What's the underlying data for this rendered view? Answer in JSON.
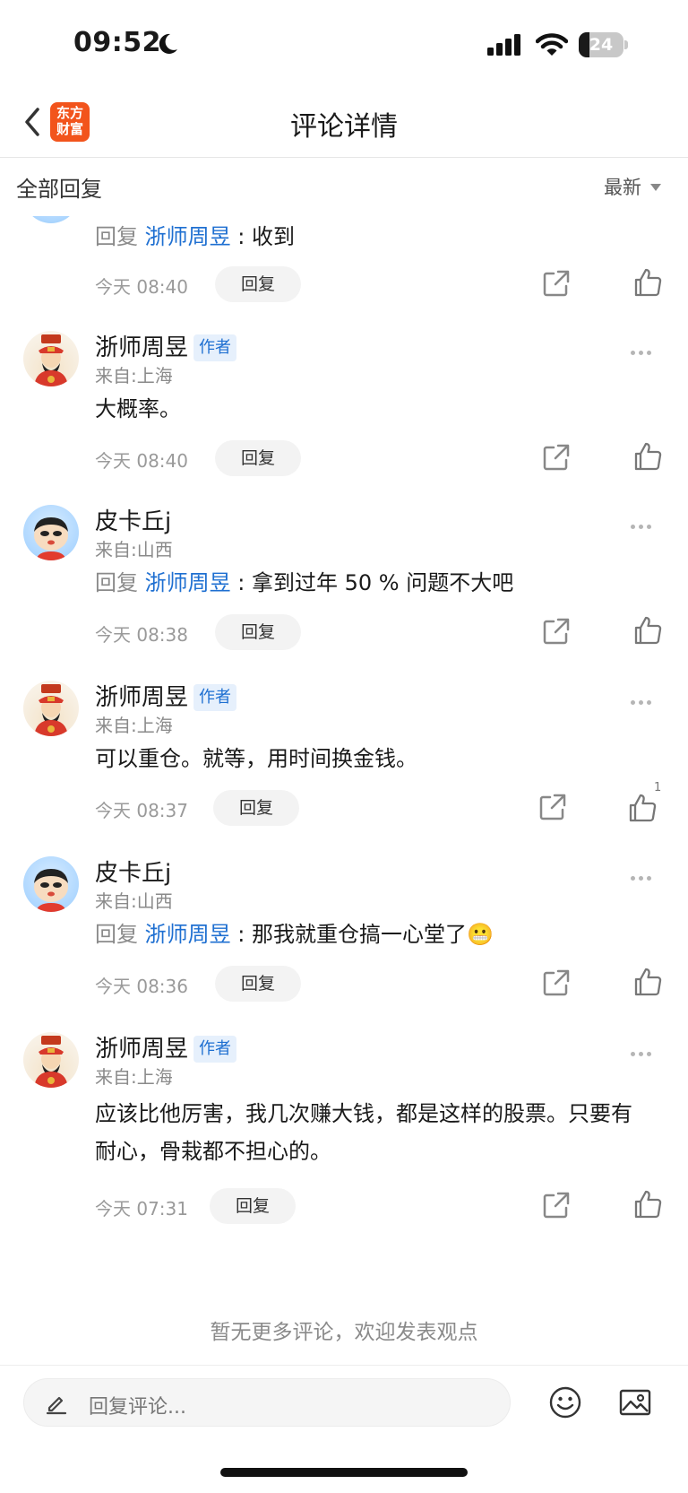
{
  "status_bar": {
    "time": "09:52",
    "battery": "24",
    "battery_level_percent": 24
  },
  "nav": {
    "logo_line1": "东方",
    "logo_line2": "财富",
    "title": "评论详情"
  },
  "filter": {
    "label": "全部回复",
    "sort": "最新"
  },
  "strings": {
    "author_badge": "作者",
    "reply_prefix": "回复",
    "reply_sep": ":",
    "reply_button": "回复"
  },
  "comments": [
    {
      "reply_to": "浙师周昱",
      "text": "收到",
      "time": "今天 08:40"
    },
    {
      "name": "浙师周昱",
      "is_author": true,
      "location": "来自:上海",
      "text": "大概率。",
      "time": "今天 08:40"
    },
    {
      "name": "皮卡丘j",
      "location": "来自:山西",
      "reply_to": "浙师周昱",
      "text": "拿到过年 50 % 问题不大吧",
      "time": "今天 08:38"
    },
    {
      "name": "浙师周昱",
      "is_author": true,
      "location": "来自:上海",
      "text": "可以重仓。就等，用时间换金钱。",
      "time": "今天 08:37",
      "likes": "1"
    },
    {
      "name": "皮卡丘j",
      "location": "来自:山西",
      "reply_to": "浙师周昱",
      "text": "那我就重仓搞一心堂了😬",
      "time": "今天 08:36"
    },
    {
      "name": "浙师周昱",
      "is_author": true,
      "location": "来自:上海",
      "text": "应该比他厉害，我几次赚大钱，都是这样的股票。只要有耐心，骨栽都不担心的。",
      "time": "今天 07:31"
    }
  ],
  "footer_note": "暂无更多评论，欢迎发表观点",
  "input": {
    "placeholder": "回复评论..."
  },
  "colors": {
    "link_blue": "#1e6fd1",
    "brand_orange": "#f2541c",
    "text_gray": "#8a8a8a"
  },
  "icons": [
    "back-arrow-icon",
    "moon-icon",
    "signal-icon",
    "wifi-icon",
    "battery-icon",
    "more-dots-icon",
    "share-icon",
    "thumbs-up-icon",
    "pencil-icon",
    "emoji-icon",
    "image-icon"
  ]
}
